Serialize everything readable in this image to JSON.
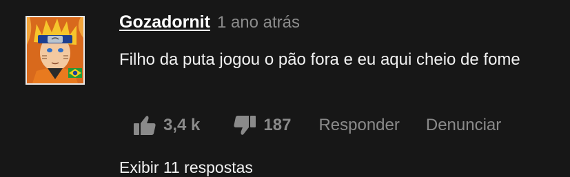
{
  "comment": {
    "author": "Gozadornit",
    "time": "1 ano atrás",
    "text": "Filho da puta jogou o pão fora e eu aqui cheio de fome",
    "likes": "3,4 k",
    "dislikes": "187",
    "reply_label": "Responder",
    "report_label": "Denunciar",
    "view_replies": "Exibir 11 respostas"
  },
  "icons": {
    "avatar": "naruto-avatar-with-brazil-flag",
    "like": "thumbs-up-icon",
    "dislike": "thumbs-down-icon"
  },
  "colors": {
    "background": "#171717",
    "author": "#ffffff",
    "muted": "#8c8c8c",
    "text": "#f1f1f1"
  }
}
